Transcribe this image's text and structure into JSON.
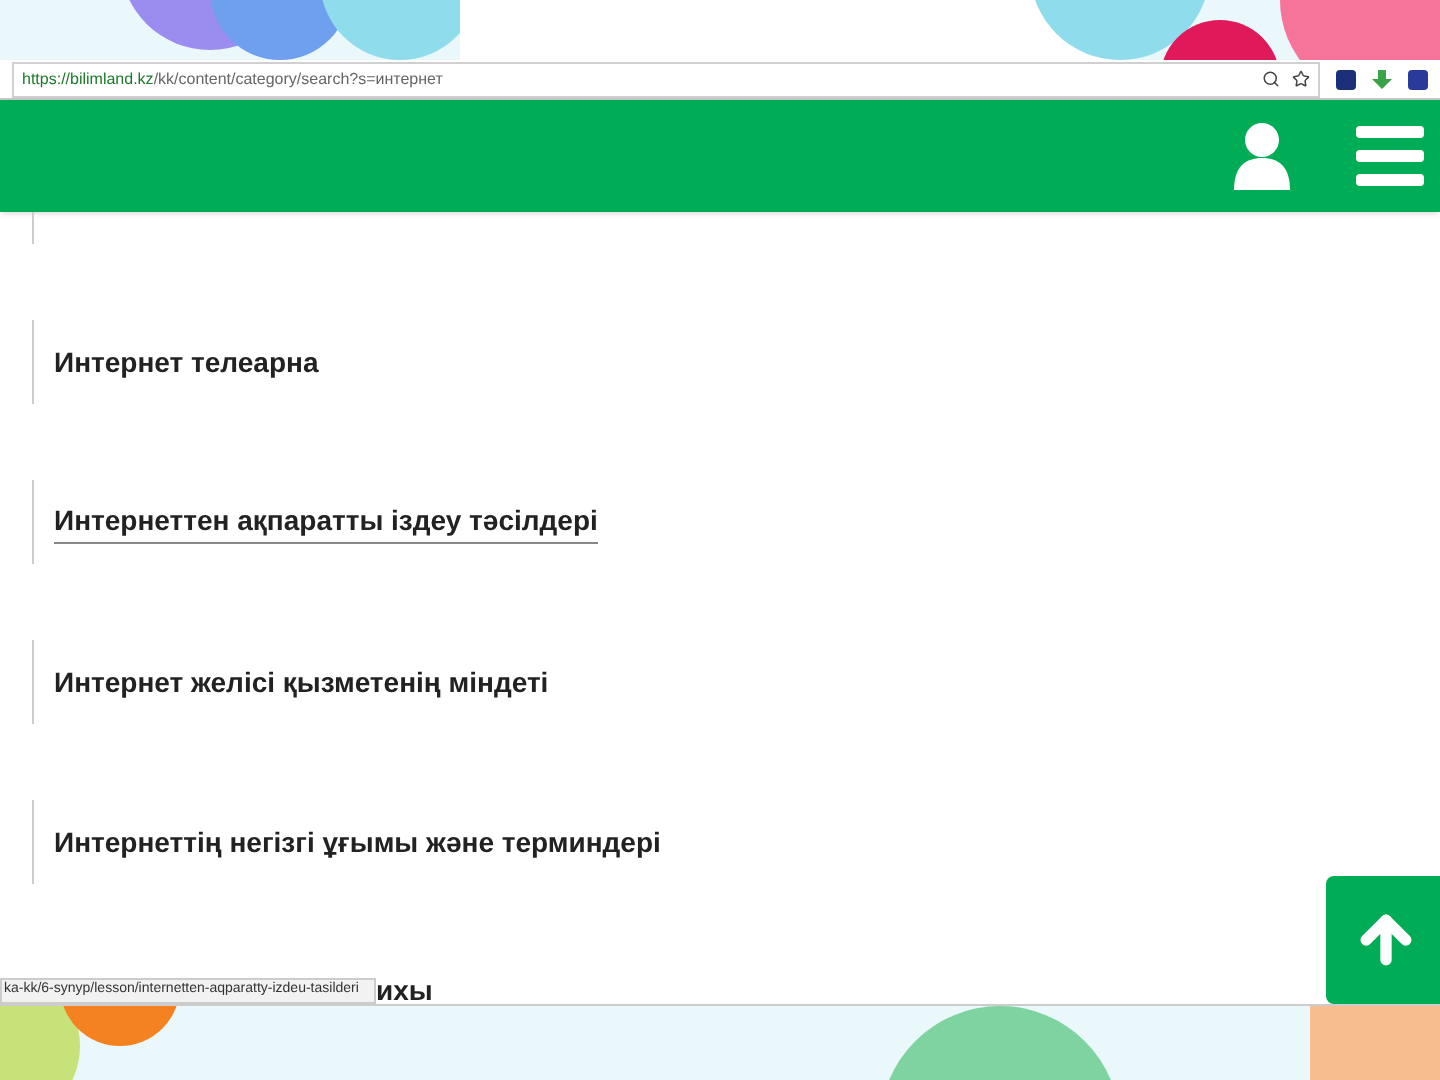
{
  "address_bar": {
    "url_host": "https://bilimland.kz",
    "url_path": "/kk/content/category/search?s=интернет"
  },
  "results": [
    {
      "title": "Интернет телеарна",
      "hovered": false
    },
    {
      "title": "Интернеттен ақпаратты іздеу тәсілдері",
      "hovered": true
    },
    {
      "title": "Интернет желісі қызметенің міндеті",
      "hovered": false
    },
    {
      "title": "Интернеттің негізгі ұғымы және терминдері",
      "hovered": false
    }
  ],
  "partial_result": {
    "title": "ихы"
  },
  "status_url": "ka-kk/6-synyp/lesson/internetten-aqparatty-izdeu-tasilderi"
}
